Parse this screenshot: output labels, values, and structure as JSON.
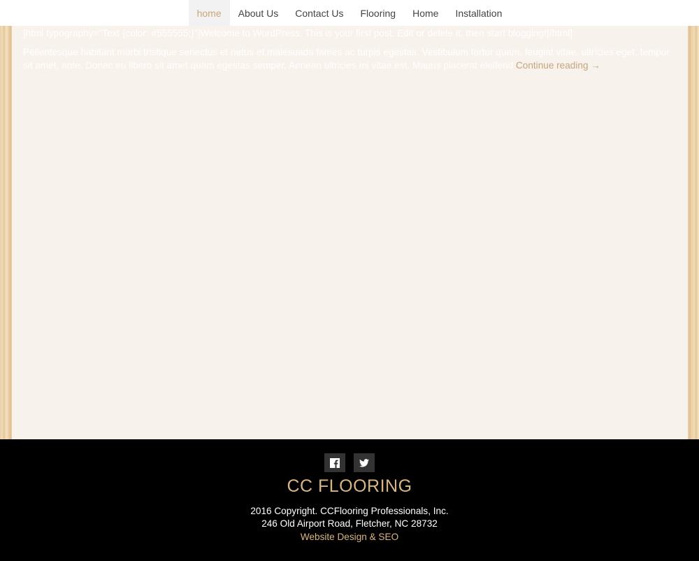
{
  "nav": {
    "items": [
      {
        "label": "home",
        "active": true
      },
      {
        "label": "About Us"
      },
      {
        "label": "Contact Us"
      },
      {
        "label": "Flooring"
      },
      {
        "label": "Home"
      },
      {
        "label": "Installation"
      }
    ]
  },
  "post": {
    "line1": "[html typography=\"Text {color: #555555;}\"]Welcome to WordPress. This is your first post. Edit or delete it, then start blogging![/html]",
    "excerpt": "Pellentesque habitant morbi tristique senectus et netus et malesuada fames ac turpis egestas. Vestibulum tortor quam, feugiat vitae, ultricies eget, tempor sit amet, ante. Donec eu libero sit amet quam egestas semper. Aenean ultricies mi vitae est. Mauris placerat eleifend",
    "more": "Continue reading →"
  },
  "footer": {
    "brand": "CC FLOORING",
    "copyright": "2016 Copyright. CCFlooring Professionals, Inc.",
    "address": "246 Old Airport Road, Fletcher, NC 28732",
    "design_link": "Website Design & SEO",
    "social_icons": [
      "facebook-icon",
      "twitter-icon"
    ]
  },
  "colors": {
    "accent": "#c7a57c",
    "brand": "#d9b584",
    "panel": "#f7f2eb"
  }
}
